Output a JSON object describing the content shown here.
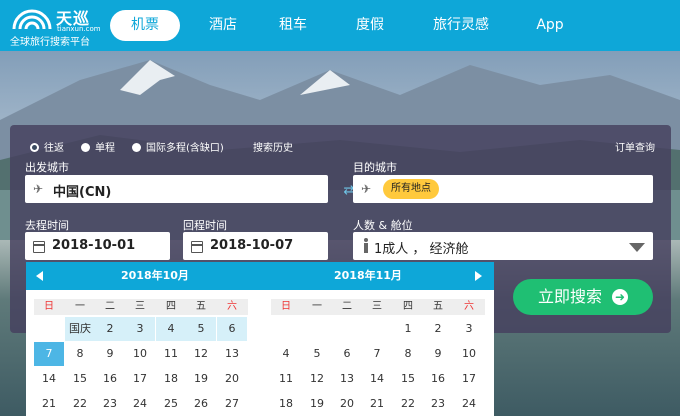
{
  "header": {
    "brand": "天巡",
    "domain": "tianxun.com",
    "slogan": "全球旅行搜索平台",
    "nav": [
      "机票",
      "酒店",
      "租车",
      "度假",
      "旅行灵感",
      "App"
    ],
    "active_tab": "机票",
    "accent_color": "#0ea7d8"
  },
  "search_form": {
    "trip_types": [
      "往返",
      "单程",
      "国际多程(含缺口)"
    ],
    "selected_trip": "往返",
    "history_link": "搜索历史",
    "order_link": "订单查询",
    "from_label": "出发城市",
    "from_value": "中国(CN)",
    "to_label": "目的城市",
    "to_badge": "所有地点",
    "depart_label": "去程时间",
    "depart_value": "2018-10-01",
    "return_label": "回程时间",
    "return_value": "2018-10-07",
    "pax_label": "人数 & 舱位",
    "pax_value": "1成人 ， 经济舱",
    "search_button": "立即搜索",
    "search_color": "#1fbf73"
  },
  "calendar": {
    "months": [
      "2018年10月",
      "2018年11月"
    ],
    "weekdays": [
      "日",
      "一",
      "二",
      "三",
      "四",
      "五",
      "六"
    ],
    "october_rows": [
      [
        "",
        "国庆",
        "2",
        "3",
        "4",
        "5",
        "6"
      ],
      [
        "7",
        "8",
        "9",
        "10",
        "11",
        "12",
        "13"
      ],
      [
        "14",
        "15",
        "16",
        "17",
        "18",
        "19",
        "20"
      ],
      [
        "21",
        "22",
        "23",
        "24",
        "25",
        "26",
        "27"
      ]
    ],
    "november_rows": [
      [
        "",
        "",
        "",
        "",
        "1",
        "2",
        "3"
      ],
      [
        "4",
        "5",
        "6",
        "7",
        "8",
        "9",
        "10"
      ],
      [
        "11",
        "12",
        "13",
        "14",
        "15",
        "16",
        "17"
      ],
      [
        "18",
        "19",
        "20",
        "21",
        "22",
        "23",
        "24"
      ]
    ]
  }
}
